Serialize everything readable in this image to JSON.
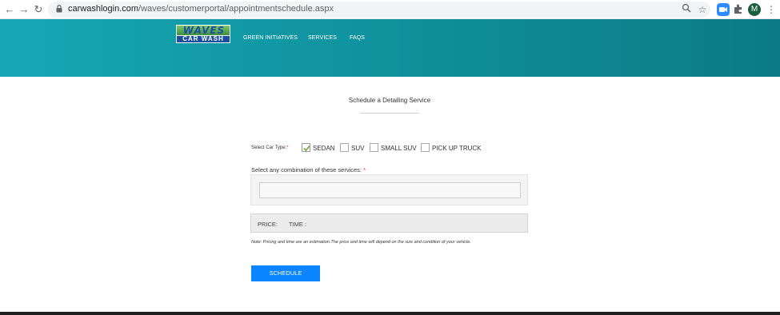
{
  "browser": {
    "url_host": "carwashlogin.com",
    "url_path": "/waves/customerportal/appointmentschedule.aspx",
    "profile_initial": "M",
    "zoom_ext_icon": "video-icon"
  },
  "header": {
    "logo_top": "WAVES",
    "logo_bottom": "CAR WASH",
    "nav": [
      "GREEN INITIATIVES",
      "SERVICES",
      "FAQS"
    ]
  },
  "page": {
    "title": "Schedule a Detailing Service"
  },
  "car_type": {
    "label": "Select Car Type:",
    "required_mark": "*",
    "options": [
      {
        "label": "SEDAN",
        "checked": true
      },
      {
        "label": "SUV",
        "checked": false
      },
      {
        "label": "SMALL SUV",
        "checked": false
      },
      {
        "label": "PICK UP TRUCK",
        "checked": false
      }
    ]
  },
  "services": {
    "label": "Select any combination of these services:",
    "required_mark": "*",
    "value": ""
  },
  "summary": {
    "price_label": "PRICE:",
    "time_label": "TIME :"
  },
  "note": "Note: Pricing and time are an estimation.The price and time will depend on the size and condition of your vehicle.",
  "actions": {
    "schedule_label": "SCHEDULE"
  },
  "colors": {
    "header_teal": "#0f8f9a",
    "button_blue": "#0a84ff",
    "check_green": "#6aaa3a"
  }
}
